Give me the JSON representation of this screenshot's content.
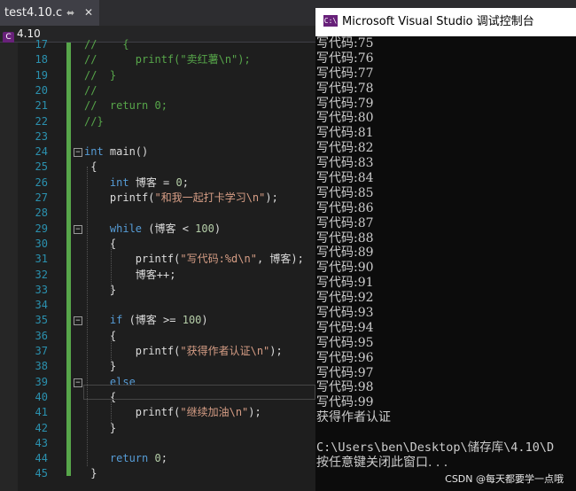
{
  "tab": {
    "filename": "test4.10.c",
    "pin_icon": "pin-icon",
    "close_icon": "close-icon"
  },
  "nav": {
    "project": "4.10",
    "project_icon": "c-project-icon"
  },
  "editor": {
    "lines": [
      {
        "num": "17",
        "parts": [
          {
            "t": "//    {",
            "c": "cm"
          }
        ]
      },
      {
        "num": "18",
        "parts": [
          {
            "t": "//      printf(\"卖红薯\\n\");",
            "c": "cm"
          }
        ]
      },
      {
        "num": "19",
        "parts": [
          {
            "t": "//  }",
            "c": "cm"
          }
        ]
      },
      {
        "num": "20",
        "parts": [
          {
            "t": "//",
            "c": "cm"
          }
        ]
      },
      {
        "num": "21",
        "parts": [
          {
            "t": "//  return 0;",
            "c": "cm"
          }
        ]
      },
      {
        "num": "22",
        "parts": [
          {
            "t": "//}",
            "c": "cm"
          }
        ]
      },
      {
        "num": "23",
        "parts": []
      },
      {
        "num": "24",
        "fold": "−",
        "parts": [
          {
            "t": "int",
            "c": "kw"
          },
          {
            "t": " main()",
            "c": ""
          }
        ]
      },
      {
        "num": "25",
        "parts": [
          {
            "t": " {",
            "c": ""
          }
        ]
      },
      {
        "num": "26",
        "parts": [
          {
            "t": "    ",
            "c": ""
          },
          {
            "t": "int",
            "c": "kw"
          },
          {
            "t": " 博客 = ",
            "c": ""
          },
          {
            "t": "0",
            "c": "nm"
          },
          {
            "t": ";",
            "c": ""
          }
        ]
      },
      {
        "num": "27",
        "parts": [
          {
            "t": "    printf(",
            "c": ""
          },
          {
            "t": "\"和我一起打卡学习\\n\"",
            "c": "st"
          },
          {
            "t": ");",
            "c": ""
          }
        ]
      },
      {
        "num": "28",
        "parts": []
      },
      {
        "num": "29",
        "fold": "−",
        "parts": [
          {
            "t": "    ",
            "c": ""
          },
          {
            "t": "while",
            "c": "kw"
          },
          {
            "t": " (博客 < ",
            "c": ""
          },
          {
            "t": "100",
            "c": "nm"
          },
          {
            "t": ")",
            "c": ""
          }
        ]
      },
      {
        "num": "30",
        "parts": [
          {
            "t": "    {",
            "c": ""
          }
        ]
      },
      {
        "num": "31",
        "parts": [
          {
            "t": "        printf(",
            "c": ""
          },
          {
            "t": "\"写代码:%d\\n\"",
            "c": "st"
          },
          {
            "t": ", 博客);",
            "c": ""
          }
        ]
      },
      {
        "num": "32",
        "parts": [
          {
            "t": "        博客++;",
            "c": ""
          }
        ]
      },
      {
        "num": "33",
        "parts": [
          {
            "t": "    }",
            "c": ""
          }
        ]
      },
      {
        "num": "34",
        "parts": []
      },
      {
        "num": "35",
        "fold": "−",
        "parts": [
          {
            "t": "    ",
            "c": ""
          },
          {
            "t": "if",
            "c": "kw"
          },
          {
            "t": " (博客 >= ",
            "c": ""
          },
          {
            "t": "100",
            "c": "nm"
          },
          {
            "t": ")",
            "c": ""
          }
        ]
      },
      {
        "num": "36",
        "parts": [
          {
            "t": "    {",
            "c": ""
          }
        ]
      },
      {
        "num": "37",
        "parts": [
          {
            "t": "        printf(",
            "c": ""
          },
          {
            "t": "\"获得作者认证\\n\"",
            "c": "st"
          },
          {
            "t": ");",
            "c": ""
          }
        ]
      },
      {
        "num": "38",
        "parts": [
          {
            "t": "    }",
            "c": ""
          }
        ]
      },
      {
        "num": "39",
        "fold": "−",
        "parts": [
          {
            "t": "    ",
            "c": ""
          },
          {
            "t": "else",
            "c": "kw"
          }
        ]
      },
      {
        "num": "40",
        "parts": [
          {
            "t": "    {",
            "c": ""
          }
        ]
      },
      {
        "num": "41",
        "parts": [
          {
            "t": "        printf(",
            "c": ""
          },
          {
            "t": "\"继续加油\\n\"",
            "c": "st"
          },
          {
            "t": ");",
            "c": ""
          }
        ]
      },
      {
        "num": "42",
        "parts": [
          {
            "t": "    }",
            "c": ""
          }
        ]
      },
      {
        "num": "43",
        "parts": []
      },
      {
        "num": "44",
        "parts": [
          {
            "t": "    ",
            "c": ""
          },
          {
            "t": "return",
            "c": "kw"
          },
          {
            "t": " ",
            "c": ""
          },
          {
            "t": "0",
            "c": "nm"
          },
          {
            "t": ";",
            "c": ""
          }
        ]
      },
      {
        "num": "45",
        "parts": [
          {
            "t": " }",
            "c": ""
          }
        ]
      }
    ]
  },
  "console": {
    "title": "Microsoft Visual Studio 调试控制台",
    "app_icon": "visual-studio-icon",
    "lines": [
      "写代码:75",
      "写代码:76",
      "写代码:77",
      "写代码:78",
      "写代码:79",
      "写代码:80",
      "写代码:81",
      "写代码:82",
      "写代码:83",
      "写代码:84",
      "写代码:85",
      "写代码:86",
      "写代码:87",
      "写代码:88",
      "写代码:89",
      "写代码:90",
      "写代码:91",
      "写代码:92",
      "写代码:93",
      "写代码:94",
      "写代码:95",
      "写代码:96",
      "写代码:97",
      "写代码:98",
      "写代码:99",
      "获得作者认证",
      "",
      "C:\\Users\\ben\\Desktop\\储存库\\4.10\\D",
      "按任意键关闭此窗口. . ."
    ],
    "watermark": "CSDN @每天都要学一点哦"
  }
}
